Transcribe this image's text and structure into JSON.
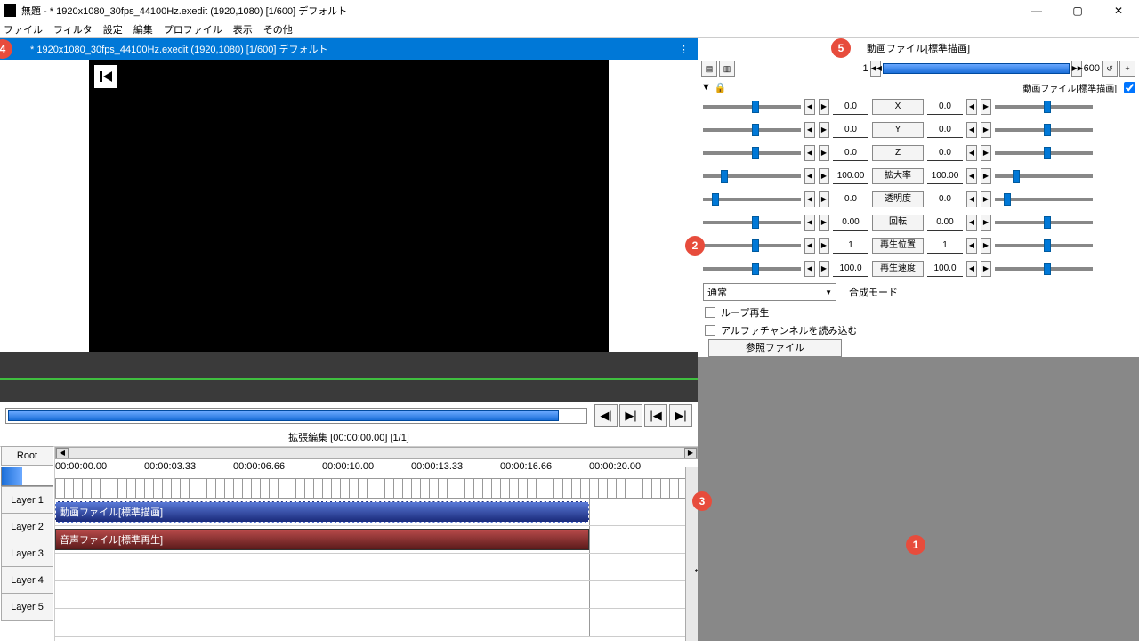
{
  "window": {
    "title": "無題 - * 1920x1080_30fps_44100Hz.exedit (1920,1080)  [1/600]  デフォルト"
  },
  "menu": {
    "file": "ファイル",
    "filter": "フィルタ",
    "settings": "設定",
    "edit": "編集",
    "profile": "プロファイル",
    "view": "表示",
    "other": "その他"
  },
  "preview": {
    "header": "* 1920x1080_30fps_44100Hz.exedit (1920,1080)  [1/600]  デフォルト"
  },
  "timeline": {
    "title": "拡張編集 [00:00:00.00] [1/1]",
    "root": "Root",
    "layers": [
      "Layer 1",
      "Layer 2",
      "Layer 3",
      "Layer 4",
      "Layer 5"
    ],
    "times": [
      "00:00:00.00",
      "00:00:03.33",
      "00:00:06.66",
      "00:00:10.00",
      "00:00:13.33",
      "00:00:16.66",
      "00:00:20.00"
    ],
    "clip_video": "動画ファイル[標準描画]",
    "clip_audio": "音声ファイル[標準再生]"
  },
  "props": {
    "title": "動画ファイル[標準描画]",
    "frame_start": "1",
    "frame_end": "600",
    "section_label": "動画ファイル[標準描画]",
    "params": [
      {
        "label": "X",
        "v1": "0.0",
        "v2": "0.0",
        "t1": 50,
        "t2": 50
      },
      {
        "label": "Y",
        "v1": "0.0",
        "v2": "0.0",
        "t1": 50,
        "t2": 50
      },
      {
        "label": "Z",
        "v1": "0.0",
        "v2": "0.0",
        "t1": 50,
        "t2": 50
      },
      {
        "label": "拡大率",
        "v1": "100.00",
        "v2": "100.00",
        "t1": 18,
        "t2": 18
      },
      {
        "label": "透明度",
        "v1": "0.0",
        "v2": "0.0",
        "t1": 9,
        "t2": 9
      },
      {
        "label": "回転",
        "v1": "0.00",
        "v2": "0.00",
        "t1": 50,
        "t2": 50
      },
      {
        "label": "再生位置",
        "v1": "1",
        "v2": "1",
        "t1": 50,
        "t2": 50
      },
      {
        "label": "再生速度",
        "v1": "100.0",
        "v2": "100.0",
        "t1": 50,
        "t2": 50
      }
    ],
    "blend_mode": "通常",
    "blend_label": "合成モード",
    "loop": "ループ再生",
    "alpha": "アルファチャンネルを読み込む",
    "ref_file": "参照ファイル"
  },
  "markers": {
    "m1": "1",
    "m2": "2",
    "m3": "3",
    "m4": "4",
    "m5": "5"
  }
}
